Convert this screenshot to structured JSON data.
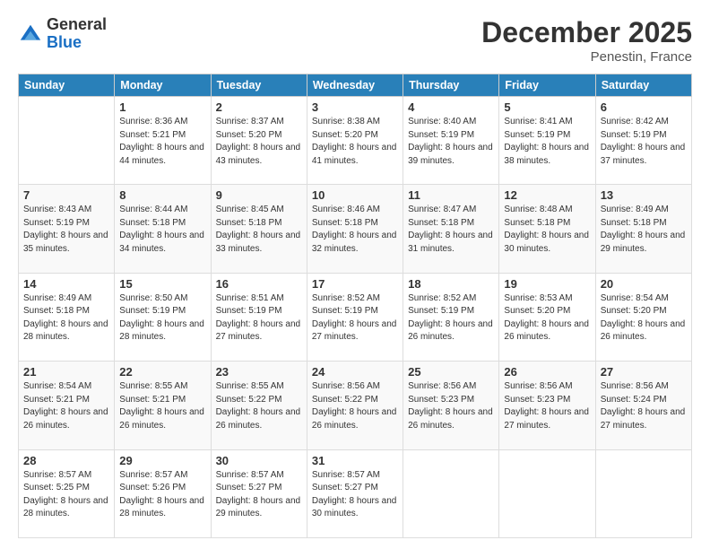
{
  "logo": {
    "general": "General",
    "blue": "Blue"
  },
  "title": "December 2025",
  "location": "Penestin, France",
  "headers": [
    "Sunday",
    "Monday",
    "Tuesday",
    "Wednesday",
    "Thursday",
    "Friday",
    "Saturday"
  ],
  "weeks": [
    [
      {
        "day": "",
        "sunrise": "",
        "sunset": "",
        "daylight": ""
      },
      {
        "day": "1",
        "sunrise": "Sunrise: 8:36 AM",
        "sunset": "Sunset: 5:21 PM",
        "daylight": "Daylight: 8 hours and 44 minutes."
      },
      {
        "day": "2",
        "sunrise": "Sunrise: 8:37 AM",
        "sunset": "Sunset: 5:20 PM",
        "daylight": "Daylight: 8 hours and 43 minutes."
      },
      {
        "day": "3",
        "sunrise": "Sunrise: 8:38 AM",
        "sunset": "Sunset: 5:20 PM",
        "daylight": "Daylight: 8 hours and 41 minutes."
      },
      {
        "day": "4",
        "sunrise": "Sunrise: 8:40 AM",
        "sunset": "Sunset: 5:19 PM",
        "daylight": "Daylight: 8 hours and 39 minutes."
      },
      {
        "day": "5",
        "sunrise": "Sunrise: 8:41 AM",
        "sunset": "Sunset: 5:19 PM",
        "daylight": "Daylight: 8 hours and 38 minutes."
      },
      {
        "day": "6",
        "sunrise": "Sunrise: 8:42 AM",
        "sunset": "Sunset: 5:19 PM",
        "daylight": "Daylight: 8 hours and 37 minutes."
      }
    ],
    [
      {
        "day": "7",
        "sunrise": "Sunrise: 8:43 AM",
        "sunset": "Sunset: 5:19 PM",
        "daylight": "Daylight: 8 hours and 35 minutes."
      },
      {
        "day": "8",
        "sunrise": "Sunrise: 8:44 AM",
        "sunset": "Sunset: 5:18 PM",
        "daylight": "Daylight: 8 hours and 34 minutes."
      },
      {
        "day": "9",
        "sunrise": "Sunrise: 8:45 AM",
        "sunset": "Sunset: 5:18 PM",
        "daylight": "Daylight: 8 hours and 33 minutes."
      },
      {
        "day": "10",
        "sunrise": "Sunrise: 8:46 AM",
        "sunset": "Sunset: 5:18 PM",
        "daylight": "Daylight: 8 hours and 32 minutes."
      },
      {
        "day": "11",
        "sunrise": "Sunrise: 8:47 AM",
        "sunset": "Sunset: 5:18 PM",
        "daylight": "Daylight: 8 hours and 31 minutes."
      },
      {
        "day": "12",
        "sunrise": "Sunrise: 8:48 AM",
        "sunset": "Sunset: 5:18 PM",
        "daylight": "Daylight: 8 hours and 30 minutes."
      },
      {
        "day": "13",
        "sunrise": "Sunrise: 8:49 AM",
        "sunset": "Sunset: 5:18 PM",
        "daylight": "Daylight: 8 hours and 29 minutes."
      }
    ],
    [
      {
        "day": "14",
        "sunrise": "Sunrise: 8:49 AM",
        "sunset": "Sunset: 5:18 PM",
        "daylight": "Daylight: 8 hours and 28 minutes."
      },
      {
        "day": "15",
        "sunrise": "Sunrise: 8:50 AM",
        "sunset": "Sunset: 5:19 PM",
        "daylight": "Daylight: 8 hours and 28 minutes."
      },
      {
        "day": "16",
        "sunrise": "Sunrise: 8:51 AM",
        "sunset": "Sunset: 5:19 PM",
        "daylight": "Daylight: 8 hours and 27 minutes."
      },
      {
        "day": "17",
        "sunrise": "Sunrise: 8:52 AM",
        "sunset": "Sunset: 5:19 PM",
        "daylight": "Daylight: 8 hours and 27 minutes."
      },
      {
        "day": "18",
        "sunrise": "Sunrise: 8:52 AM",
        "sunset": "Sunset: 5:19 PM",
        "daylight": "Daylight: 8 hours and 26 minutes."
      },
      {
        "day": "19",
        "sunrise": "Sunrise: 8:53 AM",
        "sunset": "Sunset: 5:20 PM",
        "daylight": "Daylight: 8 hours and 26 minutes."
      },
      {
        "day": "20",
        "sunrise": "Sunrise: 8:54 AM",
        "sunset": "Sunset: 5:20 PM",
        "daylight": "Daylight: 8 hours and 26 minutes."
      }
    ],
    [
      {
        "day": "21",
        "sunrise": "Sunrise: 8:54 AM",
        "sunset": "Sunset: 5:21 PM",
        "daylight": "Daylight: 8 hours and 26 minutes."
      },
      {
        "day": "22",
        "sunrise": "Sunrise: 8:55 AM",
        "sunset": "Sunset: 5:21 PM",
        "daylight": "Daylight: 8 hours and 26 minutes."
      },
      {
        "day": "23",
        "sunrise": "Sunrise: 8:55 AM",
        "sunset": "Sunset: 5:22 PM",
        "daylight": "Daylight: 8 hours and 26 minutes."
      },
      {
        "day": "24",
        "sunrise": "Sunrise: 8:56 AM",
        "sunset": "Sunset: 5:22 PM",
        "daylight": "Daylight: 8 hours and 26 minutes."
      },
      {
        "day": "25",
        "sunrise": "Sunrise: 8:56 AM",
        "sunset": "Sunset: 5:23 PM",
        "daylight": "Daylight: 8 hours and 26 minutes."
      },
      {
        "day": "26",
        "sunrise": "Sunrise: 8:56 AM",
        "sunset": "Sunset: 5:23 PM",
        "daylight": "Daylight: 8 hours and 27 minutes."
      },
      {
        "day": "27",
        "sunrise": "Sunrise: 8:56 AM",
        "sunset": "Sunset: 5:24 PM",
        "daylight": "Daylight: 8 hours and 27 minutes."
      }
    ],
    [
      {
        "day": "28",
        "sunrise": "Sunrise: 8:57 AM",
        "sunset": "Sunset: 5:25 PM",
        "daylight": "Daylight: 8 hours and 28 minutes."
      },
      {
        "day": "29",
        "sunrise": "Sunrise: 8:57 AM",
        "sunset": "Sunset: 5:26 PM",
        "daylight": "Daylight: 8 hours and 28 minutes."
      },
      {
        "day": "30",
        "sunrise": "Sunrise: 8:57 AM",
        "sunset": "Sunset: 5:27 PM",
        "daylight": "Daylight: 8 hours and 29 minutes."
      },
      {
        "day": "31",
        "sunrise": "Sunrise: 8:57 AM",
        "sunset": "Sunset: 5:27 PM",
        "daylight": "Daylight: 8 hours and 30 minutes."
      },
      {
        "day": "",
        "sunrise": "",
        "sunset": "",
        "daylight": ""
      },
      {
        "day": "",
        "sunrise": "",
        "sunset": "",
        "daylight": ""
      },
      {
        "day": "",
        "sunrise": "",
        "sunset": "",
        "daylight": ""
      }
    ]
  ]
}
